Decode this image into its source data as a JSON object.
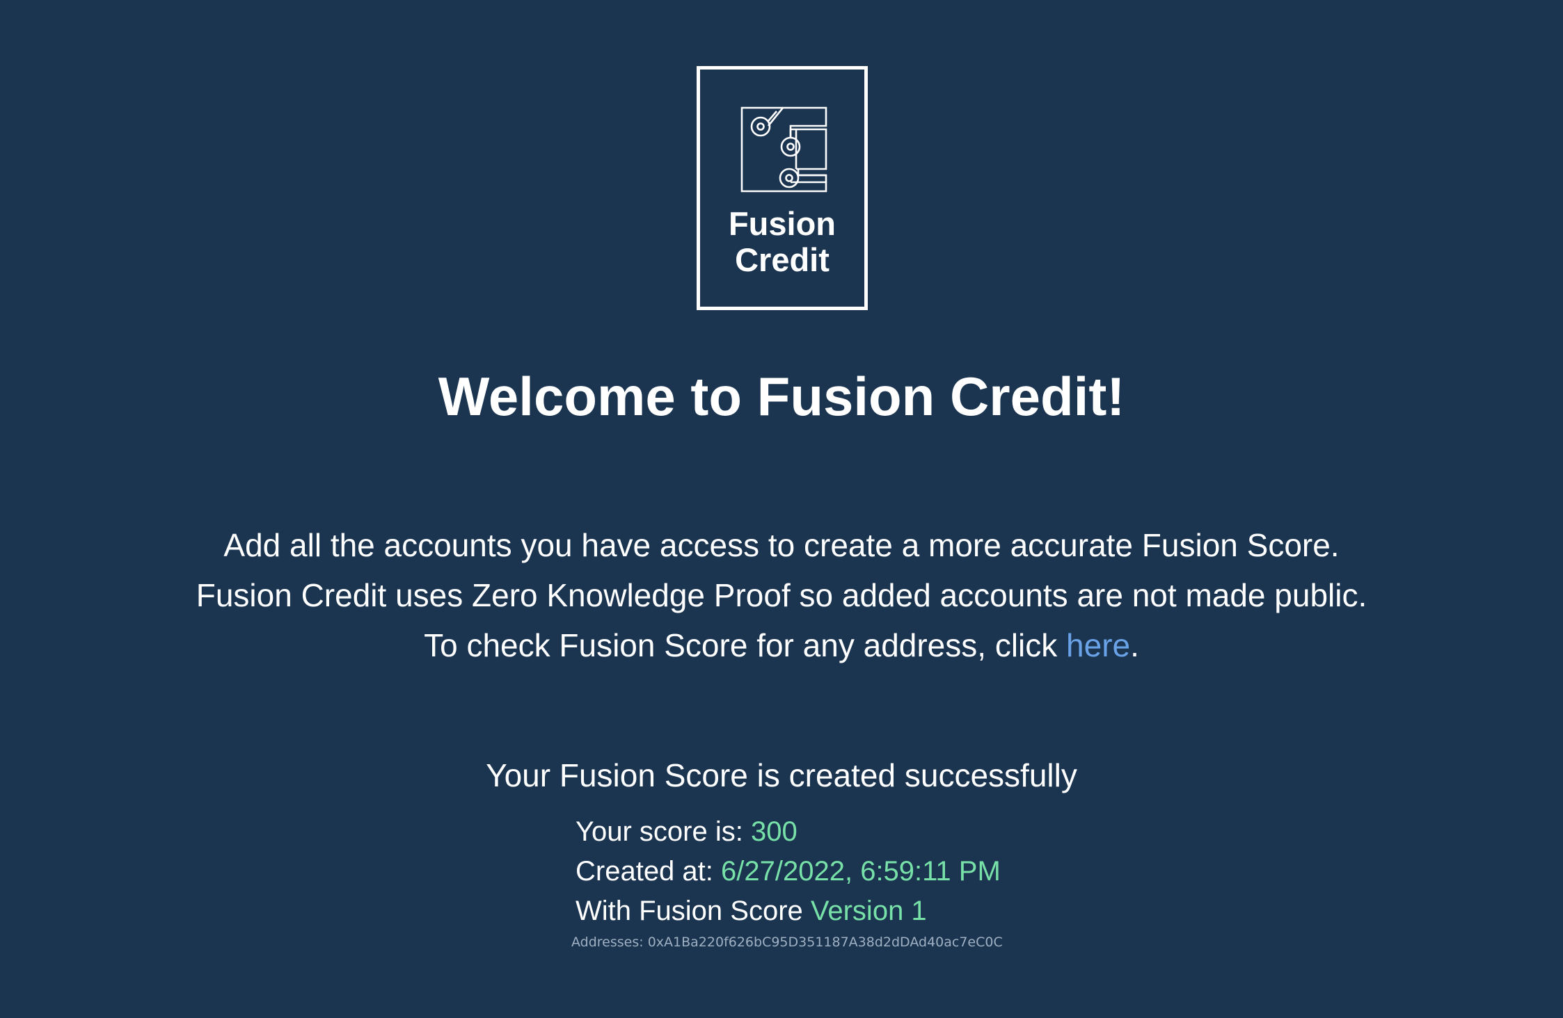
{
  "logo": {
    "line1": "Fusion",
    "line2": "Credit",
    "icon": "circuit-board-icon"
  },
  "welcome": {
    "title": "Welcome to Fusion Credit!"
  },
  "intro": {
    "line1": "Add all the accounts you have access to create a more accurate Fusion Score.",
    "line2": "Fusion Credit uses Zero Knowledge Proof so added accounts are not made public.",
    "line3_prefix": "To check Fusion Score for any address, click ",
    "link_label": "here",
    "line3_suffix": "."
  },
  "result": {
    "title": "Your Fusion Score is created successfully",
    "score_label": "Your score is: ",
    "score_value": "300",
    "created_label": "Created at: ",
    "created_value": "6/27/2022, 6:59:11 PM",
    "version_label": "With Fusion Score ",
    "version_value": "Version 1",
    "addresses": "Addresses: 0xA1Ba220f626bC95D351187A38d2dDAd40ac7eC0C"
  },
  "colors": {
    "background": "#1b3551",
    "link": "#6aa2e8",
    "highlight": "#77e1a8"
  }
}
